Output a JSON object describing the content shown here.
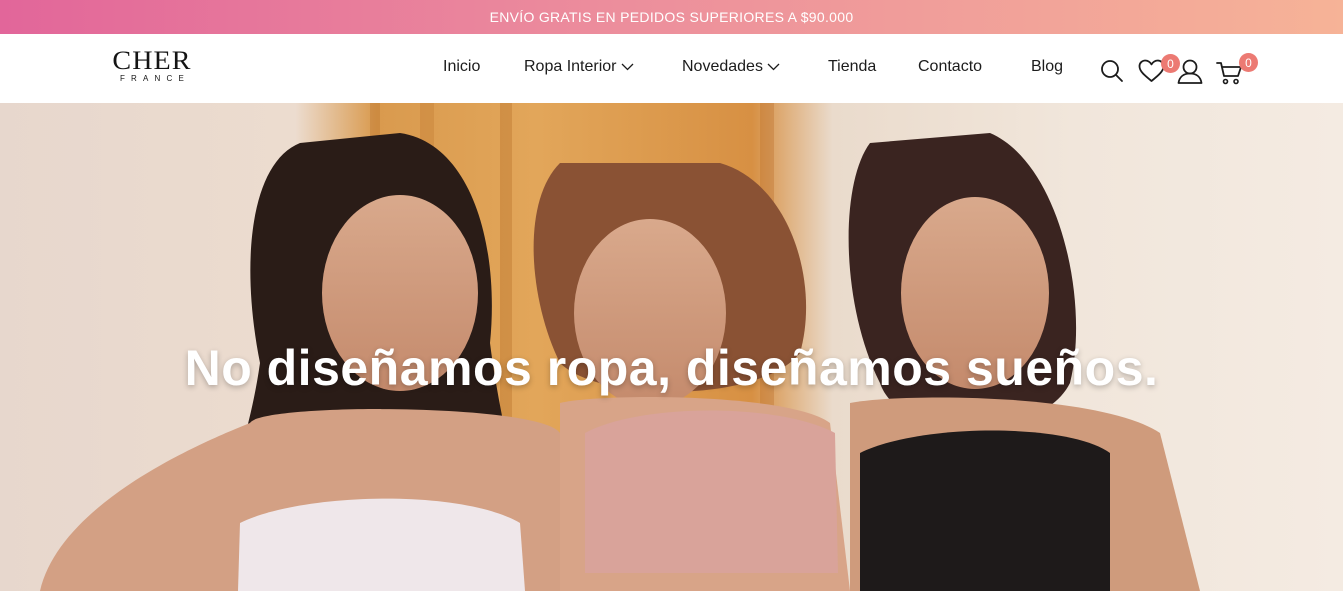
{
  "promo": {
    "text": "ENVÍO GRATIS EN PEDIDOS SUPERIORES A $90.000"
  },
  "logo": {
    "name": "CHER",
    "sub": "FRANCE"
  },
  "nav": {
    "items": [
      {
        "label": "Inicio",
        "has_dropdown": false
      },
      {
        "label": "Ropa Interior",
        "has_dropdown": true
      },
      {
        "label": "Novedades",
        "has_dropdown": true
      },
      {
        "label": "Tienda",
        "has_dropdown": false
      },
      {
        "label": "Contacto",
        "has_dropdown": false
      },
      {
        "label": "Blog",
        "has_dropdown": false
      }
    ]
  },
  "header_icons": {
    "search": "search-icon",
    "wishlist": "heart-icon",
    "wishlist_count": "0",
    "account": "user-icon",
    "cart": "cart-icon",
    "cart_count": "0"
  },
  "hero": {
    "title": "No diseñamos ropa, diseñamos sueños."
  },
  "colors": {
    "promo_start": "#e2669a",
    "promo_end": "#f6b397",
    "badge": "#ec7a73",
    "text": "#1c1c1c"
  }
}
